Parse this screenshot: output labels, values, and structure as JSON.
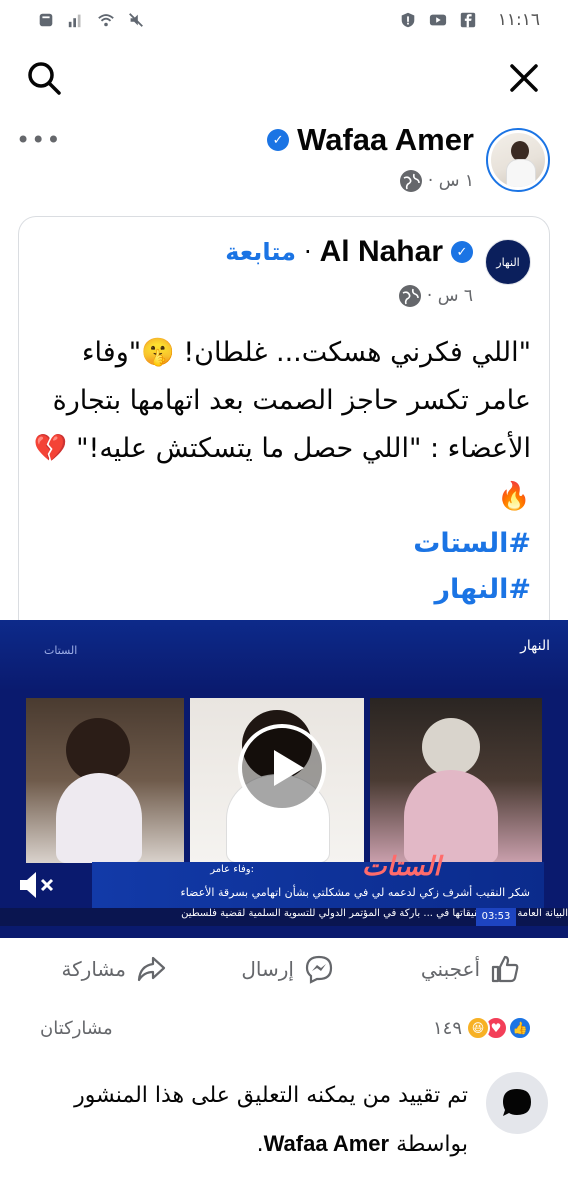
{
  "status_bar": {
    "time": "١١:١٦",
    "left_icons": [
      "notification-icon",
      "signal-icon",
      "wifi-icon",
      "mute-icon"
    ],
    "right_icons": [
      "shield-icon",
      "youtube-icon",
      "facebook-icon"
    ]
  },
  "nav": {
    "search_icon": "search-icon",
    "close_icon": "close-icon"
  },
  "post": {
    "author": "Wafaa Amer",
    "time": "١ س ·",
    "more": "•••"
  },
  "shared": {
    "page_avatar_text": "النهار",
    "page_name": "Al Nahar",
    "follow": "متابعة",
    "separator": "·",
    "time": "٦ س ·",
    "text": "\"اللي فكرني هسكت... غلطان! 🤫\"وفاء عامر تكسر حاجز الصمت بعد اتهامها بتجارة الأعضاء : \"اللي حصل ما يتسكتش عليه!\" 💔🔥",
    "hashtags": [
      "#الستات",
      "#النهار"
    ]
  },
  "video": {
    "channel": "النهار",
    "show_tag": "الستات",
    "lower_name": "وفاء عامر:",
    "lower_text": "شكر النقيب أشرف زكي لدعمه لي في مشكلتي بشأن اتهامي بسرقة الأعضاء",
    "show_logo": "الستات",
    "ticker": "البيانة العامة تباشر تحقيقاتها في ... باركة في المؤتمر الدولي للتسوية السلمية لقضية فلسطين",
    "ticker_time": "03:53"
  },
  "actions": {
    "like": "أعجبني",
    "send": "إرسال",
    "share": "مشاركة"
  },
  "stats": {
    "reaction_count": "١٤٩",
    "shares": "مشاركتان"
  },
  "notice": {
    "text_before": "تم تقييد من يمكنه التعليق على هذا المنشور بواسطة",
    "name": "Wafaa Amer",
    "text_after": "."
  },
  "colors": {
    "accent": "#1b74e4",
    "secondary_text": "#65676b"
  }
}
